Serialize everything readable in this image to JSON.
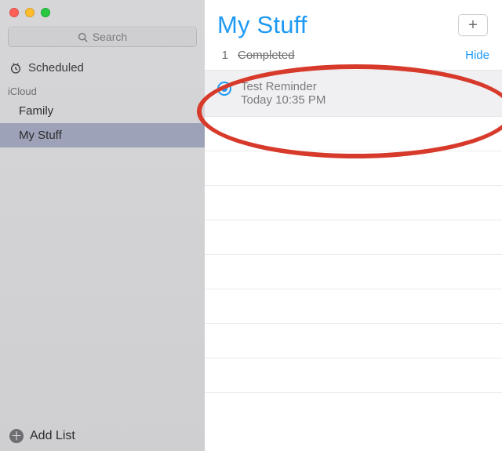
{
  "search": {
    "placeholder": "Search"
  },
  "groups": {
    "scheduled_label": "Scheduled"
  },
  "section": {
    "label": "iCloud"
  },
  "lists": [
    {
      "name": "Family",
      "selected": false
    },
    {
      "name": "My Stuff",
      "selected": true
    }
  ],
  "sidebar_footer": {
    "add_list_label": "Add List"
  },
  "main": {
    "title": "My Stuff",
    "completed_count": "1",
    "completed_label": "Completed",
    "hide_label": "Hide"
  },
  "reminder": {
    "title": "Test Reminder",
    "subtitle": "Today 10:35 PM",
    "completed": true
  },
  "icons": {
    "search": "search-icon",
    "clock": "clock-icon",
    "plus_circle": "plus-circle-icon",
    "plus": "plus-icon"
  }
}
